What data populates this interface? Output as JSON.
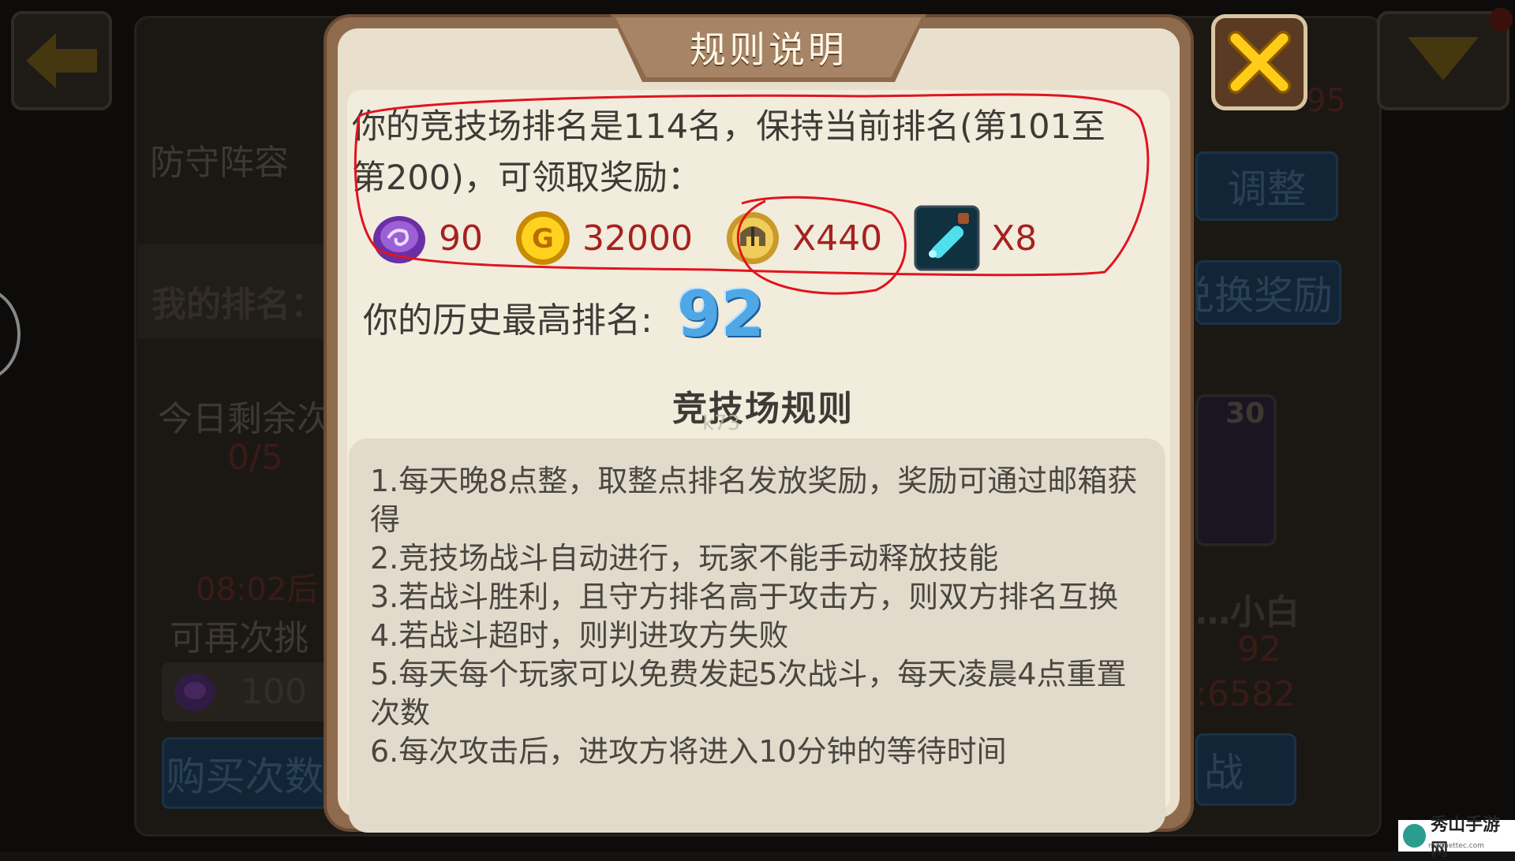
{
  "modal": {
    "title": "规则说明",
    "rank_line_1": "你的竞技场排名是114名，保持当前排名(第101至",
    "rank_line_2": "第200)，可领取奖励：",
    "rewards": [
      {
        "icon": "purple-gem-icon",
        "value": "90"
      },
      {
        "icon": "gold-coin-icon",
        "value": "32000"
      },
      {
        "icon": "helmet-medal-icon",
        "value": "X440"
      },
      {
        "icon": "potion-icon",
        "value": "X8"
      }
    ],
    "best_rank_label": "你的历史最高排名:",
    "best_rank_value": "92",
    "section_title": "竞技场规则",
    "rules": [
      "1.每天晚8点整，取整点排名发放奖励，奖励可通过邮箱获得",
      "2.竞技场战斗自动进行，玩家不能手动释放技能",
      "3.若战斗胜利，且守方排名高于攻击方，则双方排名互换",
      "4.若战斗超时，则判进攻方失败",
      "5.每天每个玩家可以免费发起5次战斗，每天凌晨4点重置次数",
      "6.每次攻击后，进攻方将进入10分钟的等待时间"
    ],
    "watermark": "k73"
  },
  "background": {
    "defense_lineup": "防守阵容",
    "my_rank": "我的排名：",
    "today_remaining": "今日剩余次",
    "count": "0/5",
    "timer": "08:02后",
    "can_again": "可再次挑",
    "cost": "100",
    "buy_button": "购买次数",
    "adjust_button": "调整",
    "exchange_button": "兑换奖励",
    "top_right_num": "95",
    "player_level": "30",
    "player_name": "…小白",
    "player_rank": "92",
    "player_power": ":6582",
    "fight_button": "战"
  },
  "badge": {
    "name": "秀山手游网",
    "url": "magnettec.com"
  },
  "colors": {
    "modal_frame": "#8f6b4d",
    "parchment": "#f2ecdd",
    "reward_text": "#a5221e",
    "best_rank": "#4fa7e6",
    "annotation": "#e0141e"
  }
}
